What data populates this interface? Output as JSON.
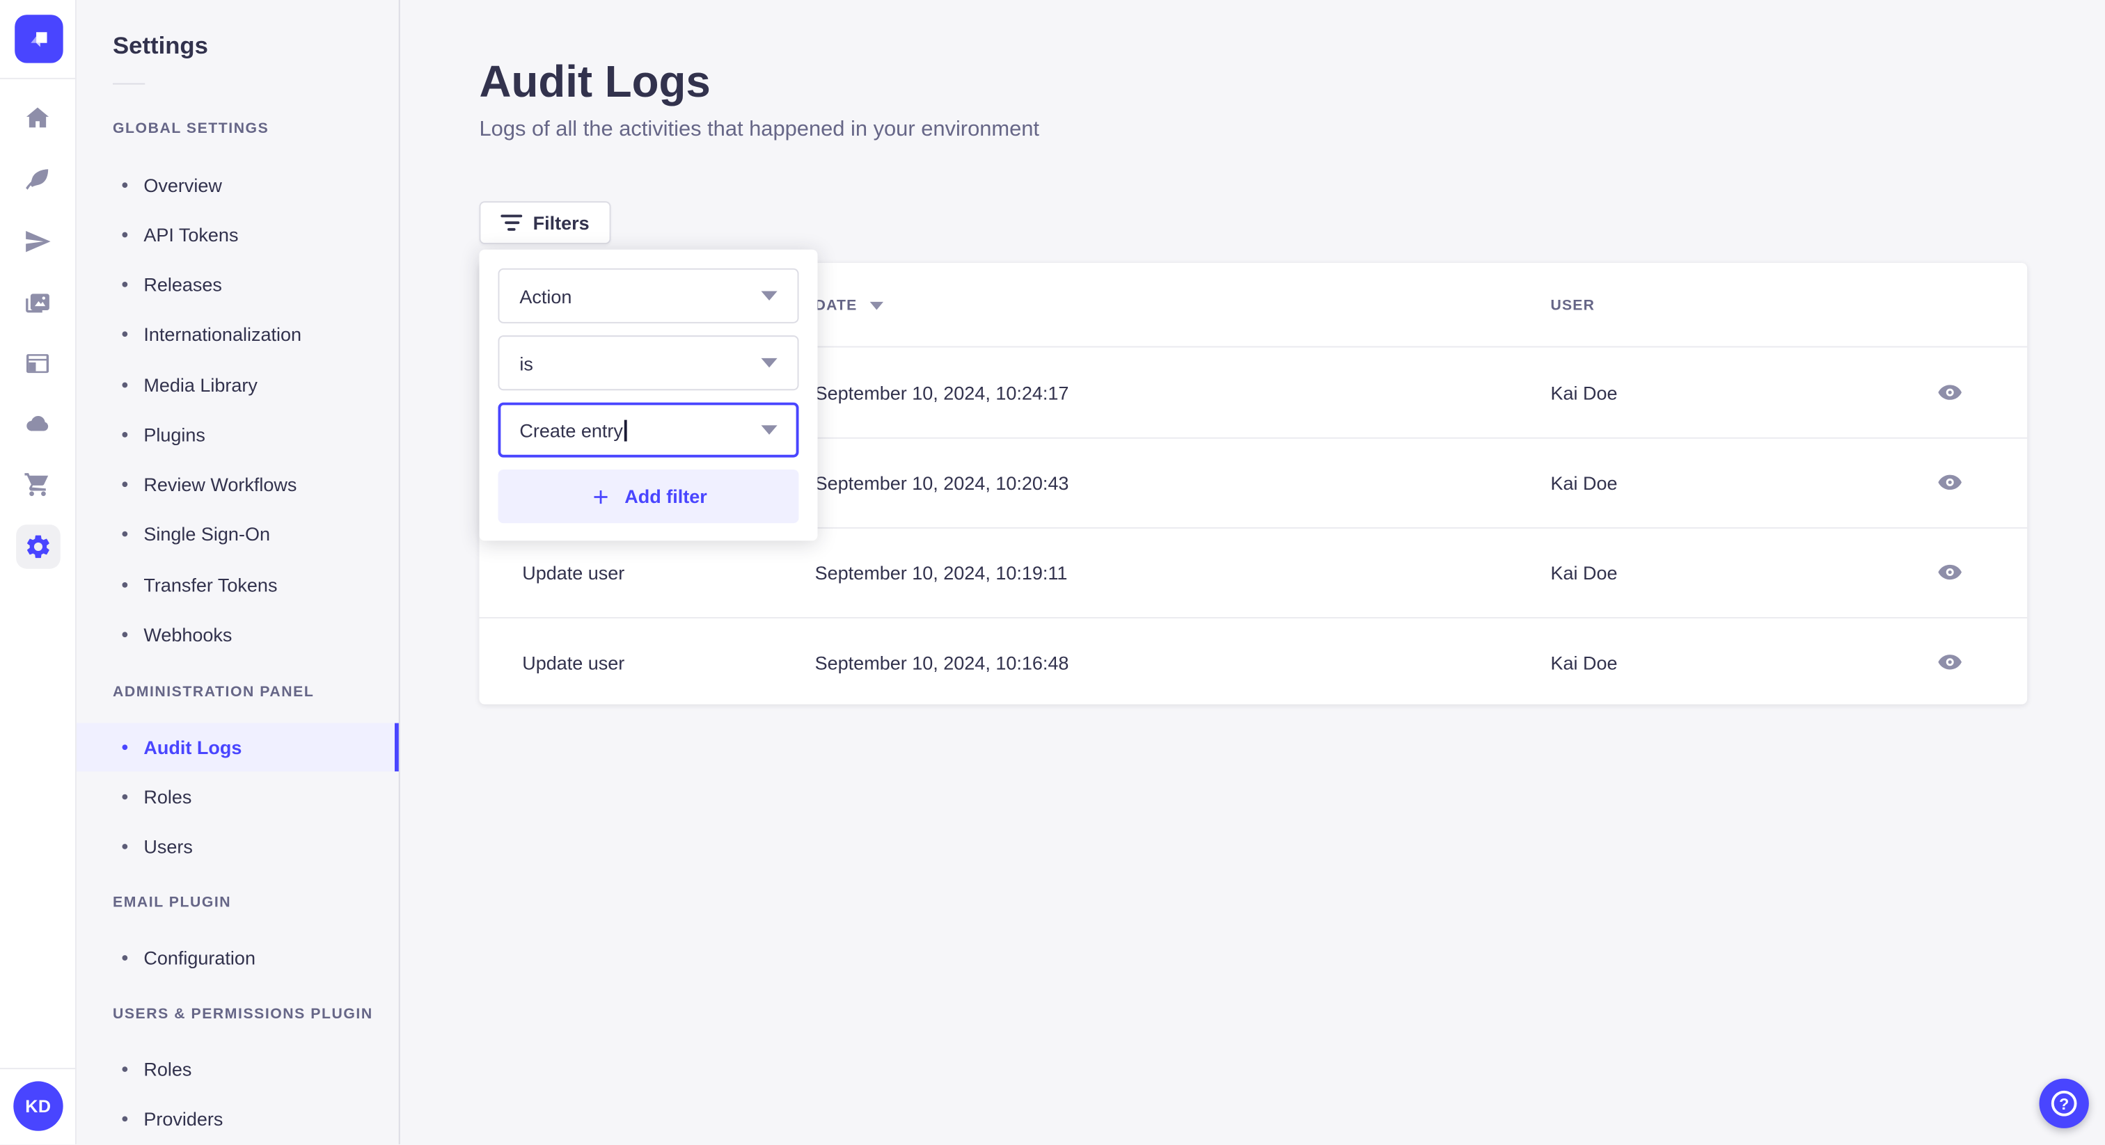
{
  "brand": {
    "accent": "#4945ff",
    "accent_light": "#f0f0ff",
    "text_dark": "#32324d",
    "text_muted": "#666687",
    "border": "#dcdce4",
    "background": "#f6f6f9"
  },
  "icon_rail": {
    "logo_icon": "strapi-logo",
    "nav_icons": [
      "home-icon",
      "feather-icon",
      "paper-plane-icon",
      "pictures-icon",
      "layout-icon",
      "cloud-icon",
      "cart-icon",
      "gear-icon"
    ],
    "active_icon": "gear-icon",
    "avatar_initials": "KD"
  },
  "sidebar": {
    "title": "Settings",
    "sections": [
      {
        "label": "GLOBAL SETTINGS",
        "items": [
          "Overview",
          "API Tokens",
          "Releases",
          "Internationalization",
          "Media Library",
          "Plugins",
          "Review Workflows",
          "Single Sign-On",
          "Transfer Tokens",
          "Webhooks"
        ]
      },
      {
        "label": "ADMINISTRATION PANEL",
        "items": [
          "Audit Logs",
          "Roles",
          "Users"
        ],
        "active_item": "Audit Logs"
      },
      {
        "label": "EMAIL PLUGIN",
        "items": [
          "Configuration"
        ]
      },
      {
        "label": "USERS & PERMISSIONS PLUGIN",
        "items": [
          "Roles",
          "Providers"
        ]
      }
    ]
  },
  "main": {
    "title": "Audit Logs",
    "subtitle": "Logs of all the activities that happened in your environment",
    "filters_button_label": "Filters"
  },
  "filter_popover": {
    "field_rows": [
      {
        "value": "Action",
        "state": "default"
      },
      {
        "value": "is",
        "state": "default"
      },
      {
        "value": "Create entry",
        "state": "focused"
      }
    ],
    "add_filter_label": "Add filter"
  },
  "table": {
    "headers": {
      "action": "",
      "date": "DATE",
      "user": "USER"
    },
    "sorted_by": "DATE",
    "sort_direction": "desc",
    "rows": [
      {
        "action": "",
        "date": "September 10, 2024, 10:24:17",
        "user": "Kai Doe"
      },
      {
        "action": "",
        "date": "September 10, 2024, 10:20:43",
        "user": "Kai Doe"
      },
      {
        "action": "Update user",
        "date": "September 10, 2024, 10:19:11",
        "user": "Kai Doe"
      },
      {
        "action": "Update user",
        "date": "September 10, 2024, 10:16:48",
        "user": "Kai Doe"
      }
    ]
  },
  "help_button": {
    "icon": "question-mark-icon",
    "glyph": "?"
  }
}
